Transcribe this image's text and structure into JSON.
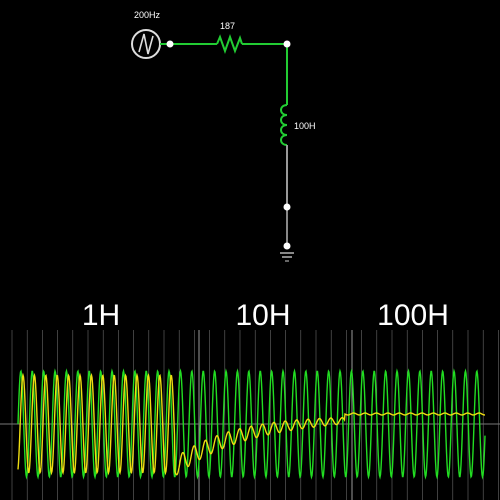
{
  "circuit": {
    "source_label": "200Hz",
    "resistor_label": "187",
    "inductor_label": "100H",
    "wire_color_active": "#22cc33",
    "wire_color_idle": "#888888",
    "source_color": "#dddddd",
    "node_color": "#ffffff"
  },
  "scope": {
    "labels": [
      "1H",
      "10H",
      "100H"
    ],
    "grid_color": "#6a6a6a",
    "axis_color": "#777777",
    "trace_colors": {
      "voltage": "#22dd22",
      "current": "#eedd11"
    }
  },
  "chart_data": {
    "type": "line",
    "title": "",
    "xlabel": "",
    "ylabel": "",
    "segments": [
      "1H",
      "10H",
      "100H"
    ],
    "series": [
      {
        "name": "",
        "color": "#22dd22",
        "shape": "sine",
        "relative_amplitude": [
          1.0,
          1.0,
          1.0
        ]
      },
      {
        "name": "",
        "color": "#eedd11",
        "shape": "sine",
        "relative_amplitude": [
          1.0,
          0.3,
          0.03
        ]
      }
    ]
  }
}
